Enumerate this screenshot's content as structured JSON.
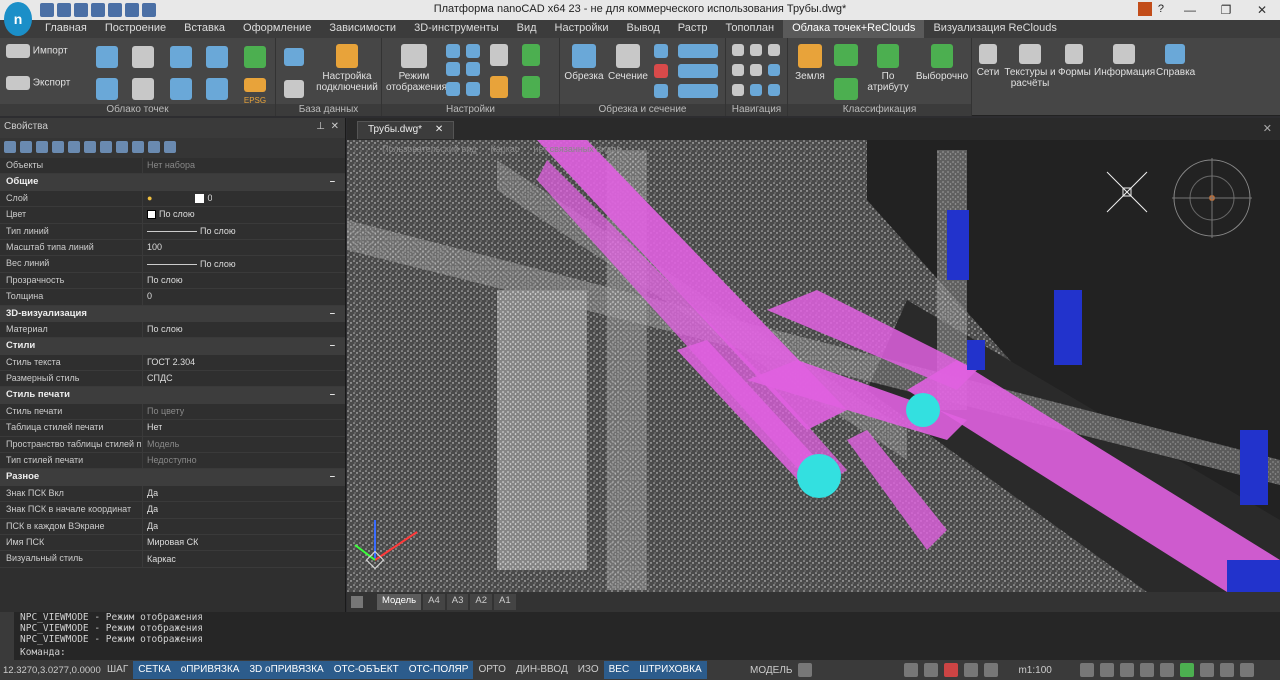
{
  "window": {
    "title": "Платформа nanoCAD x64 23 - не для коммерческого использования Трубы.dwg*"
  },
  "ribbon_tabs": [
    "Главная",
    "Построение",
    "Вставка",
    "Оформление",
    "Зависимости",
    "3D-инструменты",
    "Вид",
    "Настройки",
    "Вывод",
    "Растр",
    "Топоплан",
    "Облака точек+ReClouds",
    "Визуализация ReClouds"
  ],
  "ribbon": {
    "groups": [
      "Облако точек",
      "База данных",
      "Настройки",
      "Обрезка и сечение",
      "Навигация",
      "Классификация"
    ],
    "import": "Импорт",
    "export": "Экспорт",
    "conn_settings": "Настройка подключений",
    "view_mode": "Режим отображения",
    "clip": "Обрезка",
    "section": "Сечение",
    "ground": "Земля",
    "by_attr": "По атрибуту",
    "selective": "Выборочно",
    "nets": "Сети",
    "textures": "Текстуры и расчёты",
    "forms": "Формы",
    "info": "Информация",
    "help": "Справка",
    "epsg": "EPSG"
  },
  "props": {
    "title": "Свойства",
    "objects_key": "Объекты",
    "objects_val": "Нет набора",
    "sections": [
      {
        "name": "Общие",
        "rows": [
          {
            "k": "Слой",
            "v": "0"
          },
          {
            "k": "Цвет",
            "v": "По слою"
          },
          {
            "k": "Тип линий",
            "v": "По слою"
          },
          {
            "k": "Масштаб типа линий",
            "v": "100"
          },
          {
            "k": "Вес линий",
            "v": "По слою"
          },
          {
            "k": "Прозрачность",
            "v": "По слою"
          },
          {
            "k": "Толщина",
            "v": "0"
          }
        ]
      },
      {
        "name": "3D-визуализация",
        "rows": [
          {
            "k": "Материал",
            "v": "По слою"
          }
        ]
      },
      {
        "name": "Стили",
        "rows": [
          {
            "k": "Стиль текста",
            "v": "ГОСТ 2.304"
          },
          {
            "k": "Размерный стиль",
            "v": "СПДС"
          }
        ]
      },
      {
        "name": "Стиль печати",
        "rows": [
          {
            "k": "Стиль печати",
            "v": "По цвету"
          },
          {
            "k": "Таблица стилей печати",
            "v": "Нет"
          },
          {
            "k": "Пространство таблицы стилей п...",
            "v": "Модель"
          },
          {
            "k": "Тип стилей печати",
            "v": "Недоступно"
          }
        ]
      },
      {
        "name": "Разное",
        "rows": [
          {
            "k": "Знак ПСК Вкл",
            "v": "Да"
          },
          {
            "k": "Знак ПСК в начале координат",
            "v": "Да"
          },
          {
            "k": "ПСК в каждом ВЭкране",
            "v": "Да"
          },
          {
            "k": "Имя ПСК",
            "v": "Мировая СК"
          },
          {
            "k": "Визуальный стиль",
            "v": "Каркас"
          }
        ]
      }
    ]
  },
  "doc": {
    "tab": "Трубы.dwg*",
    "view_label_1": "Пользовательский вид",
    "view_label_2": "Каркас",
    "view_label_3": "нет связанных видов"
  },
  "model_tabs": [
    "Модель",
    "A4",
    "A3",
    "A2",
    "A1"
  ],
  "command": {
    "history": [
      "NPC_VIEWMODE - Режим отображения",
      "NPC_VIEWMODE - Режим отображения",
      "NPC_VIEWMODE - Режим отображения"
    ],
    "prompt": "Команда:"
  },
  "status": {
    "coords": "12.3270,3.0277,0.0000",
    "toggles": [
      {
        "label": "ШАГ",
        "on": false
      },
      {
        "label": "СЕТКА",
        "on": true
      },
      {
        "label": "оПРИВЯЗКА",
        "on": true
      },
      {
        "label": "3D оПРИВЯЗКА",
        "on": true
      },
      {
        "label": "ОТС-ОБЪЕКТ",
        "on": true
      },
      {
        "label": "ОТС-ПОЛЯР",
        "on": true
      },
      {
        "label": "ОРТО",
        "on": false
      },
      {
        "label": "ДИН-ВВОД",
        "on": false
      },
      {
        "label": "ИЗО",
        "on": false
      },
      {
        "label": "ВЕС",
        "on": true
      },
      {
        "label": "ШТРИХОВКА",
        "on": true
      }
    ],
    "model": "МОДЕЛЬ",
    "scale": "m1:100"
  },
  "colors": {
    "pipe": "#e060e0",
    "joint": "#33e0e0",
    "vessel": "#2233cc",
    "accent": "#2c5c8c"
  }
}
